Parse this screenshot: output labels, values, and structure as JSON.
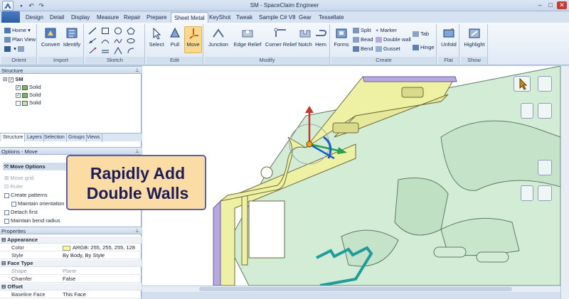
{
  "window": {
    "title": "SM - SpaceClaim Engineer",
    "qat_icons": [
      "save-icon",
      "undo-icon",
      "redo-icon"
    ]
  },
  "tabs": [
    "Design",
    "Detail",
    "Display",
    "Measure",
    "Repair",
    "Prepare",
    "Sheet Metal",
    "KeyShot",
    "Tweak",
    "Sample C# V8",
    "Gear",
    "Tessellate"
  ],
  "active_tab": "Sheet Metal",
  "ribbon": {
    "orient": {
      "label": "Orient",
      "home": "Home",
      "plan_view": "Plan View"
    },
    "import": {
      "label": "Import",
      "convert": "Convert",
      "identify": "Identify"
    },
    "sketch": {
      "label": "Sketch"
    },
    "edit": {
      "label": "Edit",
      "select": "Select",
      "pull": "Pull",
      "move": "Move"
    },
    "modify": {
      "label": "Modify",
      "junction": "Junction",
      "edge_relief": "Edge Relief",
      "corner_relief": "Corner Relief",
      "notch": "Notch",
      "hem": "Hem"
    },
    "create": {
      "label": "Create",
      "forms": "Forms",
      "split": "Split",
      "bead": "Bead",
      "bend": "Bend",
      "marker": "Marker",
      "double_wall": "Double wall",
      "gusset": "Gusset",
      "tab": "Tab",
      "hinge": "Hinge"
    },
    "flat": {
      "label": "Flat",
      "unfold": "Unfold"
    },
    "show": {
      "label": "Show",
      "highlight": "Highlight"
    }
  },
  "structure": {
    "title": "Structure",
    "root": "SM",
    "items": [
      {
        "label": "Solid",
        "checked": true
      },
      {
        "label": "Solid",
        "checked": true
      },
      {
        "label": "Solid",
        "checked": false
      }
    ],
    "tabs": [
      "Structure",
      "Layers",
      "Selection",
      "Groups",
      "Views"
    ]
  },
  "options": {
    "title": "Options - Move",
    "header": "Move Options",
    "rows": [
      "Move grid",
      "Ruler",
      "Create patterns",
      "Maintain orientation",
      "Detach first",
      "Maintain bend radius"
    ]
  },
  "properties": {
    "title": "Properties",
    "appearance": "Appearance",
    "color_key": "Color",
    "color_value": "ARGB: 255, 255, 255, 128",
    "style_key": "Style",
    "style_value": "By Body, By Style",
    "face_type": "Face Type",
    "shape_key": "Shape",
    "shape_value": "Plane",
    "chamfer_key": "Chamfer",
    "chamfer_value": "False",
    "offset": "Offset",
    "baseline_key": "Baseline Face",
    "baseline_value": "This Face"
  },
  "caption": {
    "line1": "Rapidly Add",
    "line2": "Double Walls"
  },
  "colors": {
    "part": "#eef0a4",
    "edge": "#b8a8e0",
    "background_part": "#d3ecd6",
    "highlight": "#fbd98a"
  }
}
